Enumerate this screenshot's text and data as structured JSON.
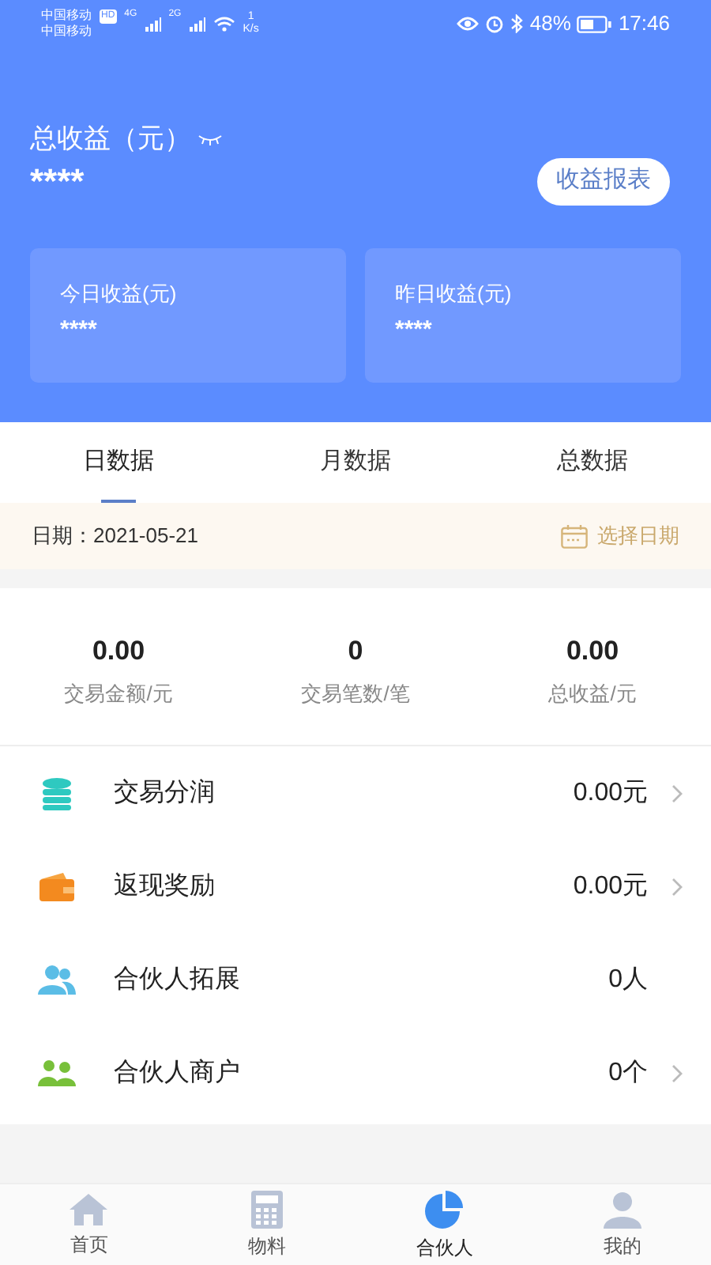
{
  "status_bar": {
    "carrier_1": "中国移动",
    "carrier_2": "中国移动",
    "hd": "HD",
    "net_1": "4G",
    "net_2": "2G",
    "speed_value": "1",
    "speed_unit": "K/s",
    "battery": "48%",
    "time": "17:46"
  },
  "header": {
    "title": "总收益（元）",
    "value": "****",
    "report_button": "收益报表"
  },
  "cards": [
    {
      "label": "今日收益(元)",
      "value": "****"
    },
    {
      "label": "昨日收益(元)",
      "value": "****"
    }
  ],
  "tabs": [
    {
      "label": "日数据",
      "selected": true
    },
    {
      "label": "月数据",
      "selected": false
    },
    {
      "label": "总数据",
      "selected": false
    }
  ],
  "date_bar": {
    "date": "日期：2021-05-21",
    "picker": "选择日期"
  },
  "stats": [
    {
      "value": "0.00",
      "label": "交易金额/元"
    },
    {
      "value": "0",
      "label": "交易笔数/笔"
    },
    {
      "value": "0.00",
      "label": "总收益/元"
    }
  ],
  "rows": [
    {
      "kind": "coins",
      "label": "交易分润",
      "value": "0.00元",
      "arrow": true
    },
    {
      "kind": "wallet",
      "label": "返现奖励",
      "value": "0.00元",
      "arrow": true
    },
    {
      "kind": "people",
      "label": "合伙人拓展",
      "value": "0人",
      "arrow": false
    },
    {
      "kind": "group",
      "label": "合伙人商户",
      "value": "0个",
      "arrow": true
    }
  ],
  "nav": [
    {
      "kind": "home",
      "label": "首页",
      "selected": false
    },
    {
      "kind": "calc",
      "label": "物料",
      "selected": false
    },
    {
      "kind": "pie",
      "label": "合伙人",
      "selected": true
    },
    {
      "kind": "user",
      "label": "我的",
      "selected": false
    }
  ]
}
